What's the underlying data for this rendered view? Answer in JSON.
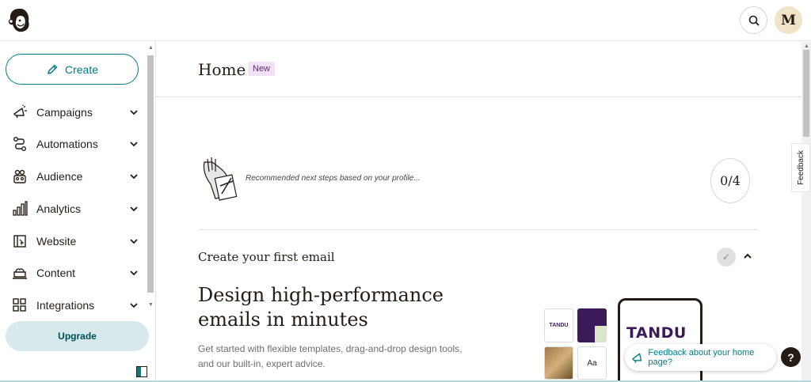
{
  "topbar": {
    "logo_icon": "freddie-chimp-logo-icon",
    "search_icon": "search-icon",
    "avatar_initial": "M"
  },
  "sidebar": {
    "create_label": "Create",
    "items": [
      {
        "label": "Campaigns",
        "icon": "megaphone-icon"
      },
      {
        "label": "Automations",
        "icon": "automation-flow-icon"
      },
      {
        "label": "Audience",
        "icon": "audience-icon"
      },
      {
        "label": "Analytics",
        "icon": "bar-chart-icon"
      },
      {
        "label": "Website",
        "icon": "website-icon"
      },
      {
        "label": "Content",
        "icon": "content-icon"
      },
      {
        "label": "Integrations",
        "icon": "integrations-grid-icon"
      }
    ],
    "upgrade_label": "Upgrade"
  },
  "main": {
    "title": "Home",
    "badge": "New",
    "feedback_tab": "Feedback",
    "recommend_text": "Recommended next steps based on your profile...",
    "progress": "0/4",
    "step_title": "Create your first email",
    "headline": "Design high-performance emails in minutes",
    "subtext": "Get started with flexible templates, drag-and-drop design tools, and our built-in, expert advice.",
    "template": {
      "logo_small": "TANDU",
      "font_sample": "Aa",
      "phone_logo": "TANDU"
    },
    "feedback_pill": "Feedback about your home page?",
    "help": "?"
  },
  "colors": {
    "accent": "#007c89",
    "text": "#241c15",
    "upgrade_bg": "#d8e9ec",
    "badge_bg": "#f3e1f7",
    "brand_purple": "#3b1a5a"
  }
}
